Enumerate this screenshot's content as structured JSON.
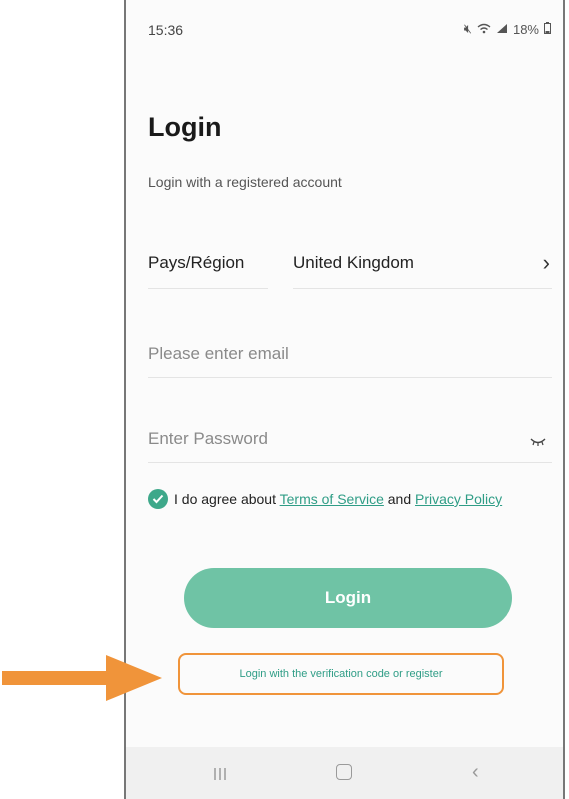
{
  "status_bar": {
    "time": "15:36",
    "battery": "18%"
  },
  "login": {
    "title": "Login",
    "subtitle": "Login with a registered account",
    "region_label": "Pays/Région",
    "region_value": "United Kingdom",
    "email_placeholder": "Please enter email",
    "password_placeholder": "Enter Password",
    "agree_prefix": "I do agree about",
    "terms_label": "Terms of Service",
    "agree_and": "and",
    "privacy_label": "Privacy Policy",
    "login_button": "Login",
    "verification_link": "Login with the verification code or register"
  },
  "colors": {
    "accent": "#6fc3a5",
    "link": "#2f9d86",
    "highlight_arrow": "#f0943a"
  },
  "icons": {
    "checkbox": "check-circle-icon",
    "password_toggle": "eye-closed-icon",
    "region": "chevron-right-icon",
    "annotation": "arrow-right-icon"
  }
}
